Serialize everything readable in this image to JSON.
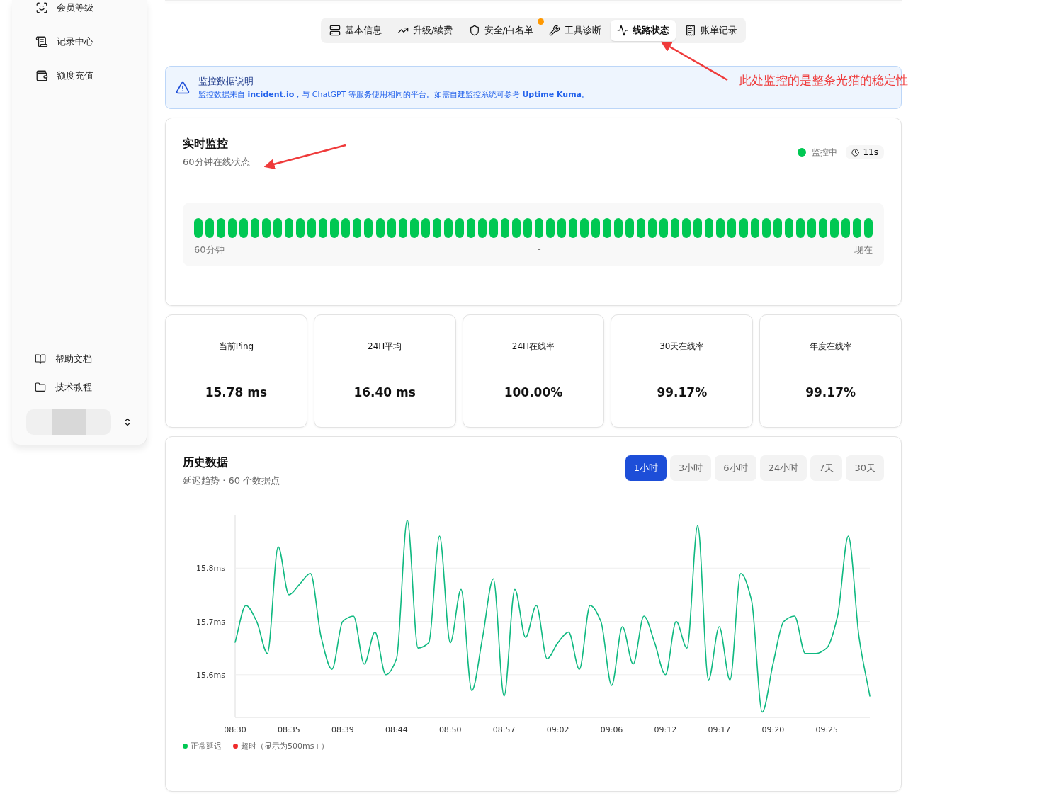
{
  "sidebar": {
    "items": [
      {
        "label": "会员等级"
      },
      {
        "label": "记录中心"
      },
      {
        "label": "额度充值"
      }
    ],
    "footer_items": [
      {
        "label": "帮助文档"
      },
      {
        "label": "技术教程"
      }
    ]
  },
  "tabs": [
    {
      "label": "基本信息",
      "selected": false,
      "dot": false
    },
    {
      "label": "升级/续费",
      "selected": false,
      "dot": false
    },
    {
      "label": "安全/白名单",
      "selected": false,
      "dot": true
    },
    {
      "label": "工具诊断",
      "selected": false,
      "dot": false
    },
    {
      "label": "线路状态",
      "selected": true,
      "dot": false
    },
    {
      "label": "账单记录",
      "selected": false,
      "dot": false
    }
  ],
  "notice": {
    "title": "监控数据说明",
    "text": "监控数据来自 **incident.io**，与 ChatGPT 等服务使用相同的平台。如需自建监控系统可参考 **Uptime Kuma**。"
  },
  "realtime": {
    "title": "实时监控",
    "subtitle": "60分钟在线状态",
    "status": "监控中",
    "active": true,
    "interval": "11s",
    "heartbeats": [
      {
        "up": true
      },
      {
        "up": true
      },
      {
        "up": true
      },
      {
        "up": true
      },
      {
        "up": true
      },
      {
        "up": true
      },
      {
        "up": true
      },
      {
        "up": true
      },
      {
        "up": true
      },
      {
        "up": true
      },
      {
        "up": true
      },
      {
        "up": true
      },
      {
        "up": true
      },
      {
        "up": true
      },
      {
        "up": true
      },
      {
        "up": true
      },
      {
        "up": true
      },
      {
        "up": true
      },
      {
        "up": true
      },
      {
        "up": true
      },
      {
        "up": true
      },
      {
        "up": true
      },
      {
        "up": true
      },
      {
        "up": true
      },
      {
        "up": true
      },
      {
        "up": true
      },
      {
        "up": true
      },
      {
        "up": true
      },
      {
        "up": true
      },
      {
        "up": true
      },
      {
        "up": true
      },
      {
        "up": true
      },
      {
        "up": true
      },
      {
        "up": true
      },
      {
        "up": true
      },
      {
        "up": true
      },
      {
        "up": true
      },
      {
        "up": true
      },
      {
        "up": true
      },
      {
        "up": true
      },
      {
        "up": true
      },
      {
        "up": true
      },
      {
        "up": true
      },
      {
        "up": true
      },
      {
        "up": true
      },
      {
        "up": true
      },
      {
        "up": true
      },
      {
        "up": true
      },
      {
        "up": true
      },
      {
        "up": true
      },
      {
        "up": true
      },
      {
        "up": true
      },
      {
        "up": true
      },
      {
        "up": true
      },
      {
        "up": true
      },
      {
        "up": true
      },
      {
        "up": true
      },
      {
        "up": true
      },
      {
        "up": true
      },
      {
        "up": true
      }
    ],
    "axis_start": "60分钟",
    "axis_mid": "-",
    "axis_end": "现在"
  },
  "stats": [
    {
      "label": "当前Ping",
      "value": "15.78 ms"
    },
    {
      "label": "24H平均",
      "value": "16.40 ms"
    },
    {
      "label": "24H在线率",
      "value": "100.00%"
    },
    {
      "label": "30天在线率",
      "value": "99.17%"
    },
    {
      "label": "年度在线率",
      "value": "99.17%"
    }
  ],
  "history": {
    "title": "历史数据",
    "subtitle": "延迟趋势 · 60 个数据点",
    "ranges": [
      {
        "label": "1小时",
        "selected": true
      },
      {
        "label": "3小时",
        "selected": false
      },
      {
        "label": "6小时",
        "selected": false
      },
      {
        "label": "24小时",
        "selected": false
      },
      {
        "label": "7天",
        "selected": false
      },
      {
        "label": "30天",
        "selected": false
      }
    ],
    "chart_data": {
      "type": "line",
      "grid": true,
      "ylim": [
        15.52,
        15.9
      ],
      "categories": [
        "08:30",
        null,
        null,
        null,
        null,
        "08:35",
        null,
        null,
        null,
        null,
        "08:39",
        null,
        null,
        null,
        null,
        "08:44",
        null,
        null,
        null,
        null,
        "08:50",
        null,
        null,
        null,
        null,
        "08:57",
        null,
        null,
        null,
        null,
        "09:02",
        null,
        null,
        null,
        null,
        "09:06",
        null,
        null,
        null,
        null,
        "09:12",
        null,
        null,
        null,
        null,
        "09:17",
        null,
        null,
        null,
        null,
        "09:20",
        null,
        null,
        null,
        null,
        "09:25",
        null,
        null,
        null,
        null
      ],
      "yticks": [
        {
          "value": 15.6,
          "label": "15.6ms"
        },
        {
          "value": 15.7,
          "label": "15.7ms"
        },
        {
          "value": 15.8,
          "label": "15.8ms"
        }
      ],
      "series": [
        {
          "color": "#10b981",
          "values": [
            15.661,
            15.73,
            15.7,
            15.64,
            15.84,
            15.75,
            15.77,
            15.79,
            15.67,
            15.61,
            15.7,
            15.71,
            15.62,
            15.68,
            15.6,
            15.63,
            15.89,
            15.65,
            15.66,
            15.86,
            15.66,
            15.76,
            15.57,
            15.67,
            15.78,
            15.56,
            15.76,
            15.67,
            15.73,
            15.63,
            15.66,
            15.68,
            15.61,
            15.73,
            15.7,
            15.58,
            15.69,
            15.62,
            15.71,
            15.66,
            15.6,
            15.7,
            15.65,
            15.88,
            15.59,
            15.69,
            15.59,
            15.79,
            15.74,
            15.53,
            15.62,
            15.7,
            15.71,
            15.64,
            15.64,
            15.65,
            15.71,
            15.86,
            15.67,
            15.56
          ]
        }
      ]
    },
    "legend": [
      {
        "label": "正常延迟",
        "color": "#00c853"
      },
      {
        "label": "超时（显示为500ms+）",
        "color": "#ef2b2b"
      }
    ]
  },
  "annotation": {
    "text": "此处监控的是整条光猫的稳定性"
  }
}
